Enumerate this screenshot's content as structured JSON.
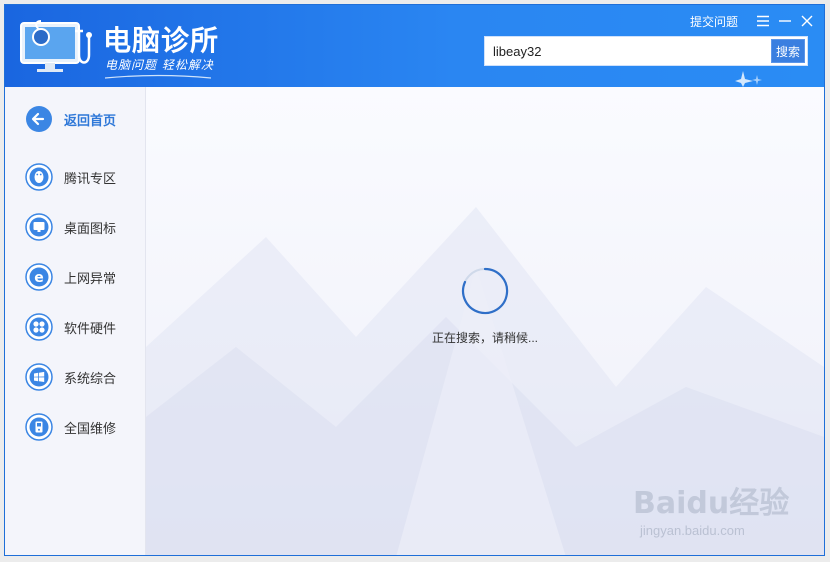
{
  "app": {
    "title": "电脑诊所",
    "slogan": "电脑问题 轻松解决"
  },
  "window_controls": {
    "feedback": "提交问题",
    "menu_icon": "menu-icon",
    "minimize_icon": "minimize-icon",
    "close_icon": "close-icon"
  },
  "search": {
    "value": "libeay32",
    "button": "搜索"
  },
  "sidebar": {
    "items": [
      {
        "label": "返回首页",
        "icon": "back-arrow-icon"
      },
      {
        "label": "腾讯专区",
        "icon": "qq-penguin-icon"
      },
      {
        "label": "桌面图标",
        "icon": "monitor-icon"
      },
      {
        "label": "上网异常",
        "icon": "ie-browser-icon"
      },
      {
        "label": "软件硬件",
        "icon": "fan-icon"
      },
      {
        "label": "系统综合",
        "icon": "windows-icon"
      },
      {
        "label": "全国维修",
        "icon": "phone-icon"
      }
    ]
  },
  "main": {
    "loading_text": "正在搜索，请稍候..."
  },
  "watermark": {
    "logo": "Baidu经验",
    "url": "jingyan.baidu.com"
  },
  "colors": {
    "titlebar": "#1a66e0",
    "accent": "#2f78d8",
    "sidebar_bg": "#f4f5fb"
  }
}
